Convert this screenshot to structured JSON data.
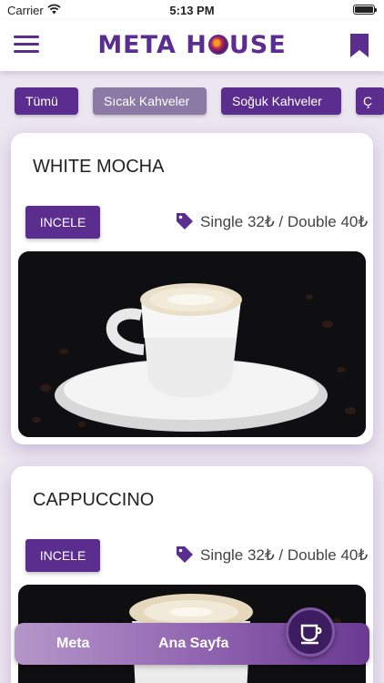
{
  "status_bar": {
    "carrier": "Carrier",
    "time": "5:13 PM"
  },
  "header": {
    "brand_before": "META H",
    "brand_after": "USE"
  },
  "categories": [
    {
      "label": "Tümü"
    },
    {
      "label": "Sıcak Kahveler",
      "active": true
    },
    {
      "label": "Soğuk Kahveler"
    },
    {
      "label": "Ç"
    }
  ],
  "products": [
    {
      "name": "WHITE MOCHA",
      "button_label": "INCELE",
      "price": "Single 32₺ / Double 40₺"
    },
    {
      "name": "CAPPUCCINO",
      "button_label": "INCELE",
      "price": "Single 32₺ / Double 40₺"
    }
  ],
  "bottom_nav": {
    "items": [
      "Meta",
      "Ana Sayfa"
    ]
  },
  "icons": {
    "menu": "menu-icon",
    "bookmark": "bookmark-icon",
    "tag": "tag-icon",
    "coffee": "coffee-cup-icon",
    "wifi": "wifi-icon",
    "battery": "battery-icon"
  },
  "colors": {
    "brand": "#5b2d8e",
    "active_category": "#8c7aa6",
    "background": "#ece6f1"
  }
}
